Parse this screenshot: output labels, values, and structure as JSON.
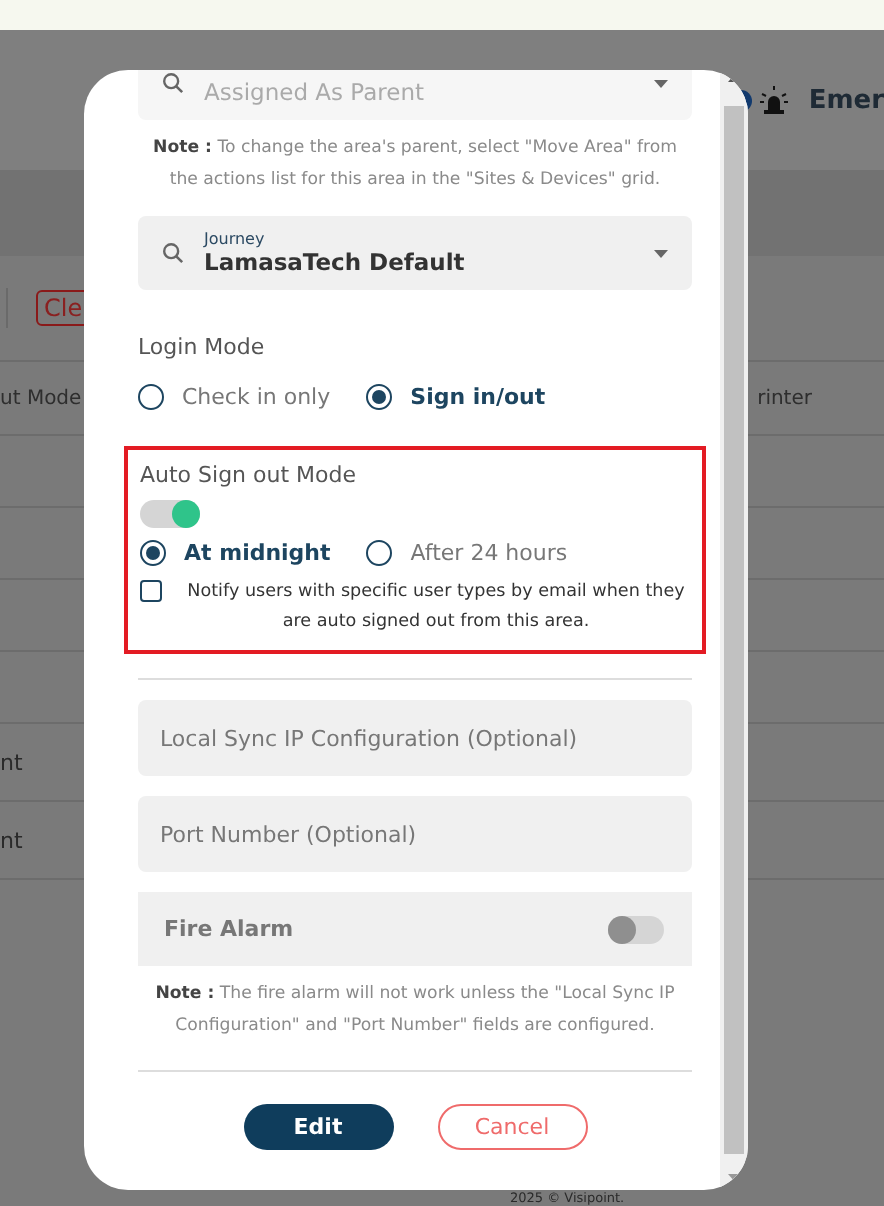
{
  "background": {
    "header_text": "Emer",
    "clear_button": "Cle",
    "column_1": "ut Mode",
    "column_2": "rinter",
    "row_texts": [
      "nt",
      "nt"
    ],
    "footer": "2025 © Visipoint."
  },
  "modal": {
    "parent_field": {
      "value": "Assigned As Parent",
      "disabled": true
    },
    "parent_note": {
      "prefix": "Note :",
      "text": "To change the area's parent, select \"Move Area\" from the actions list for this area in the \"Sites & Devices\" grid."
    },
    "journey_field": {
      "label": "Journey",
      "value": "LamasaTech Default"
    },
    "login_mode": {
      "title": "Login Mode",
      "options": [
        {
          "label": "Check in only",
          "selected": false
        },
        {
          "label": "Sign in/out",
          "selected": true
        }
      ]
    },
    "auto_sign_out": {
      "title": "Auto Sign out Mode",
      "highlighted": true,
      "on": true,
      "options": [
        {
          "label": "At midnight",
          "selected": true
        },
        {
          "label": "After 24 hours",
          "selected": false
        }
      ],
      "notify": {
        "label": "Notify users with specific user types by email when they are auto signed out from this area.",
        "checked": false
      }
    },
    "local_sync_field": {
      "placeholder": "Local Sync IP Configuration (Optional)"
    },
    "port_field": {
      "placeholder": "Port Number (Optional)"
    },
    "fire_alarm": {
      "label": "Fire Alarm",
      "on": false
    },
    "fire_note": {
      "prefix": "Note :",
      "text": "The fire alarm will not work unless the \"Local Sync IP Configuration\" and \"Port Number\" fields are configured."
    },
    "buttons": [
      {
        "label": "Edit",
        "kind": "primary"
      },
      {
        "label": "Cancel",
        "kind": "secondary"
      }
    ]
  }
}
